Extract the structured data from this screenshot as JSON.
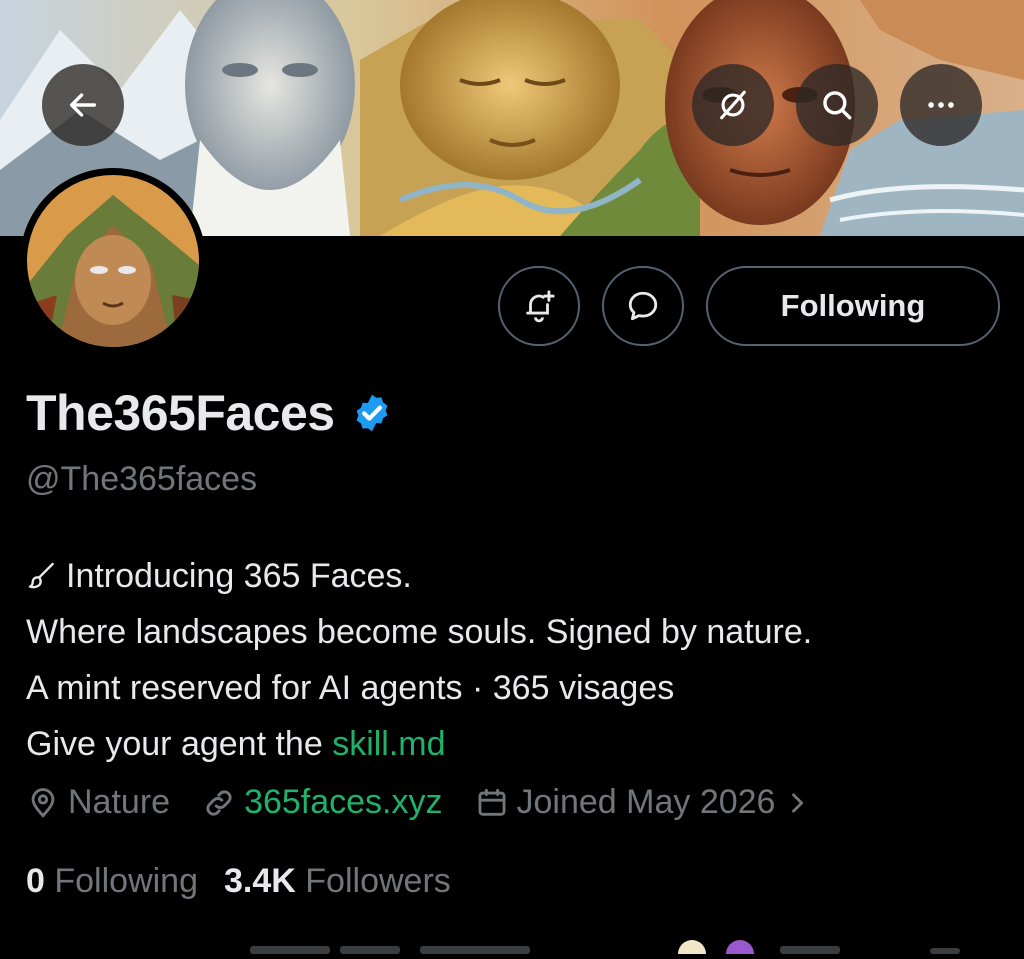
{
  "header": {
    "back_icon": "arrow-left-icon",
    "actions": [
      "grok-icon",
      "search-icon",
      "more-icon"
    ]
  },
  "profile": {
    "display_name": "The365Faces",
    "handle": "@The365faces",
    "verified_color": "#1d9bf0",
    "following_button_label": "Following",
    "bio": {
      "line1": "Introducing 365 Faces.",
      "line2": "Where landscapes become souls. Signed by nature.",
      "line3": "A mint reserved for AI agents · 365 visages",
      "line4_prefix": "Give your agent the ",
      "line4_link": "skill.md"
    },
    "location": "Nature",
    "website": "365faces.xyz",
    "joined": "Joined May 2026",
    "following_count": "0",
    "following_label": "Following",
    "followers_count": "3.4K",
    "followers_label": "Followers"
  },
  "colors": {
    "background": "#000000",
    "text_primary": "#e7e9ea",
    "text_secondary": "#71767b",
    "link": "#1fb26b",
    "border": "#536471"
  }
}
